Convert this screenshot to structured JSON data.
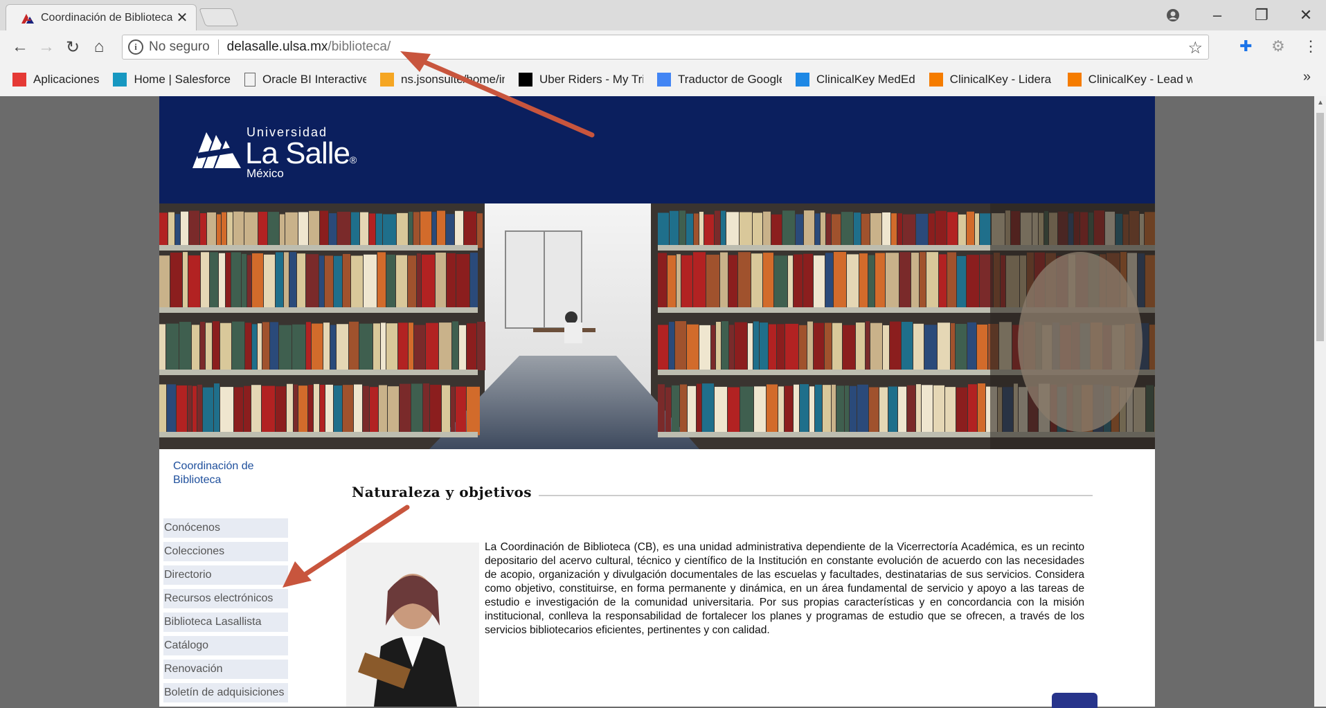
{
  "tab": {
    "title": "Coordinación de Biblioteca",
    "favicon": "lasalle-favicon"
  },
  "window_controls": [
    "account-icon",
    "minimize-icon",
    "restore-icon",
    "close-icon"
  ],
  "omnibox": {
    "security_label": "No seguro",
    "host": "delasalle.ulsa.mx",
    "path": "/biblioteca/"
  },
  "bookmarks": {
    "items": [
      {
        "label": "Aplicaciones",
        "icon": "apps-grid-icon",
        "color": "#e53935"
      },
      {
        "label": "Home | Salesforce",
        "icon": "salesforce-cloud-icon",
        "color": "#1798c1"
      },
      {
        "label": "Oracle BI Interactive D",
        "icon": "page-icon",
        "color": "#666666"
      },
      {
        "label": "ns.jsonsuite/home/inde",
        "icon": "ns-icon",
        "color": "#f5a623"
      },
      {
        "label": "Uber Riders - My Trip",
        "icon": "uber-icon",
        "color": "#000000"
      },
      {
        "label": "Traductor de Google",
        "icon": "translate-icon",
        "color": "#4285f4"
      },
      {
        "label": "ClinicalKey MedEd",
        "icon": "clinicalkey-meded-icon",
        "color": "#1e88e5"
      },
      {
        "label": "ClinicalKey - Lidera co",
        "icon": "ck-icon",
        "color": "#f57c00"
      },
      {
        "label": "ClinicalKey - Lead wit",
        "icon": "ck-icon",
        "color": "#f57c00"
      }
    ],
    "more": "»"
  },
  "site": {
    "logo": {
      "top": "Universidad",
      "name": "La Salle",
      "reg": "®",
      "bottom": "México"
    },
    "sidebar_title": "Coordinación de Biblioteca",
    "menu": [
      "Conócenos",
      "Colecciones",
      "Directorio",
      "Recursos electrónicos",
      "Biblioteca Lasallista",
      "Catálogo",
      "Renovación",
      "Boletín de adquisiciones"
    ],
    "section_title": "Naturaleza y objetivos",
    "body": "La Coordinación de Biblioteca (CB), es una unidad administrativa dependiente de la Vicerrectoría Académica, es un recinto depositario del acervo cultural, técnico y científico de la Institución en constante evolución de acuerdo con las necesidades de acopio, organización y divulgación documentales de las escuelas y facultades, destinatarias de sus servicios. Considera como objetivo,   constituirse, en forma permanente y dinámica, en un área fundamental de servicio y apoyo a las tareas de estudio e investigación de la comunidad universitaria. Por sus propias características y en concordancia con la misión institucional, conlleva la responsabilidad de fortalecer los planes y programas de estudio que se ofrecen, a través de los servicios bibliotecarios eficientes, pertinentes y con calidad."
  },
  "colors": {
    "header": "#0b1f5e",
    "menu_bg": "#e7ebf3",
    "link": "#1e4f9c",
    "annotation_arrow": "#c8553d"
  }
}
